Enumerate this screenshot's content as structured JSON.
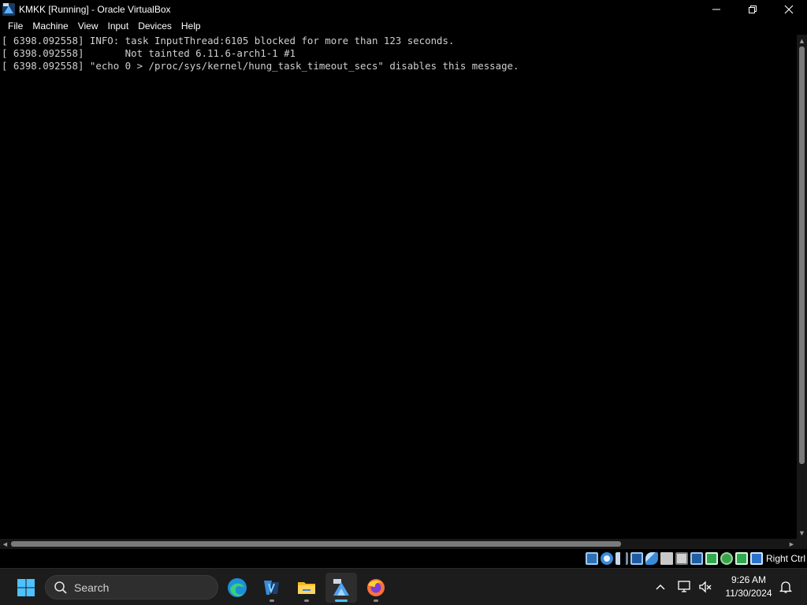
{
  "window": {
    "title": "KMKK [Running] - Oracle VirtualBox"
  },
  "menu": [
    "File",
    "Machine",
    "View",
    "Input",
    "Devices",
    "Help"
  ],
  "console": {
    "lines": [
      "[ 6398.092558] INFO: task InputThread:6105 blocked for more than 123 seconds.",
      "[ 6398.092558]       Not tainted 6.11.6-arch1-1 #1",
      "[ 6398.092558] \"echo 0 > /proc/sys/kernel/hung_task_timeout_secs\" disables this message."
    ]
  },
  "statusbar": {
    "host_key": "Right Ctrl",
    "icons": [
      "hard-disk-icon",
      "optical-drive-icon",
      "audio-icon",
      "network-icon",
      "usb-icon",
      "shared-folders-icon",
      "display-icon",
      "recording-icon",
      "video-capture-icon",
      "cpu-activity-icon",
      "mouse-integration-icon",
      "keyboard-capture-icon"
    ]
  },
  "taskbar": {
    "search_placeholder": "Search",
    "apps": [
      "start-icon",
      "edge-icon",
      "visual-studio-icon",
      "file-explorer-icon",
      "virtualbox-icon",
      "firefox-icon"
    ],
    "clock_time": "9:26 AM",
    "clock_date": "11/30/2024"
  },
  "colors": {
    "console_bg": "#000000",
    "console_text": "#cfcfcf",
    "accent": "#4cc2ff"
  }
}
